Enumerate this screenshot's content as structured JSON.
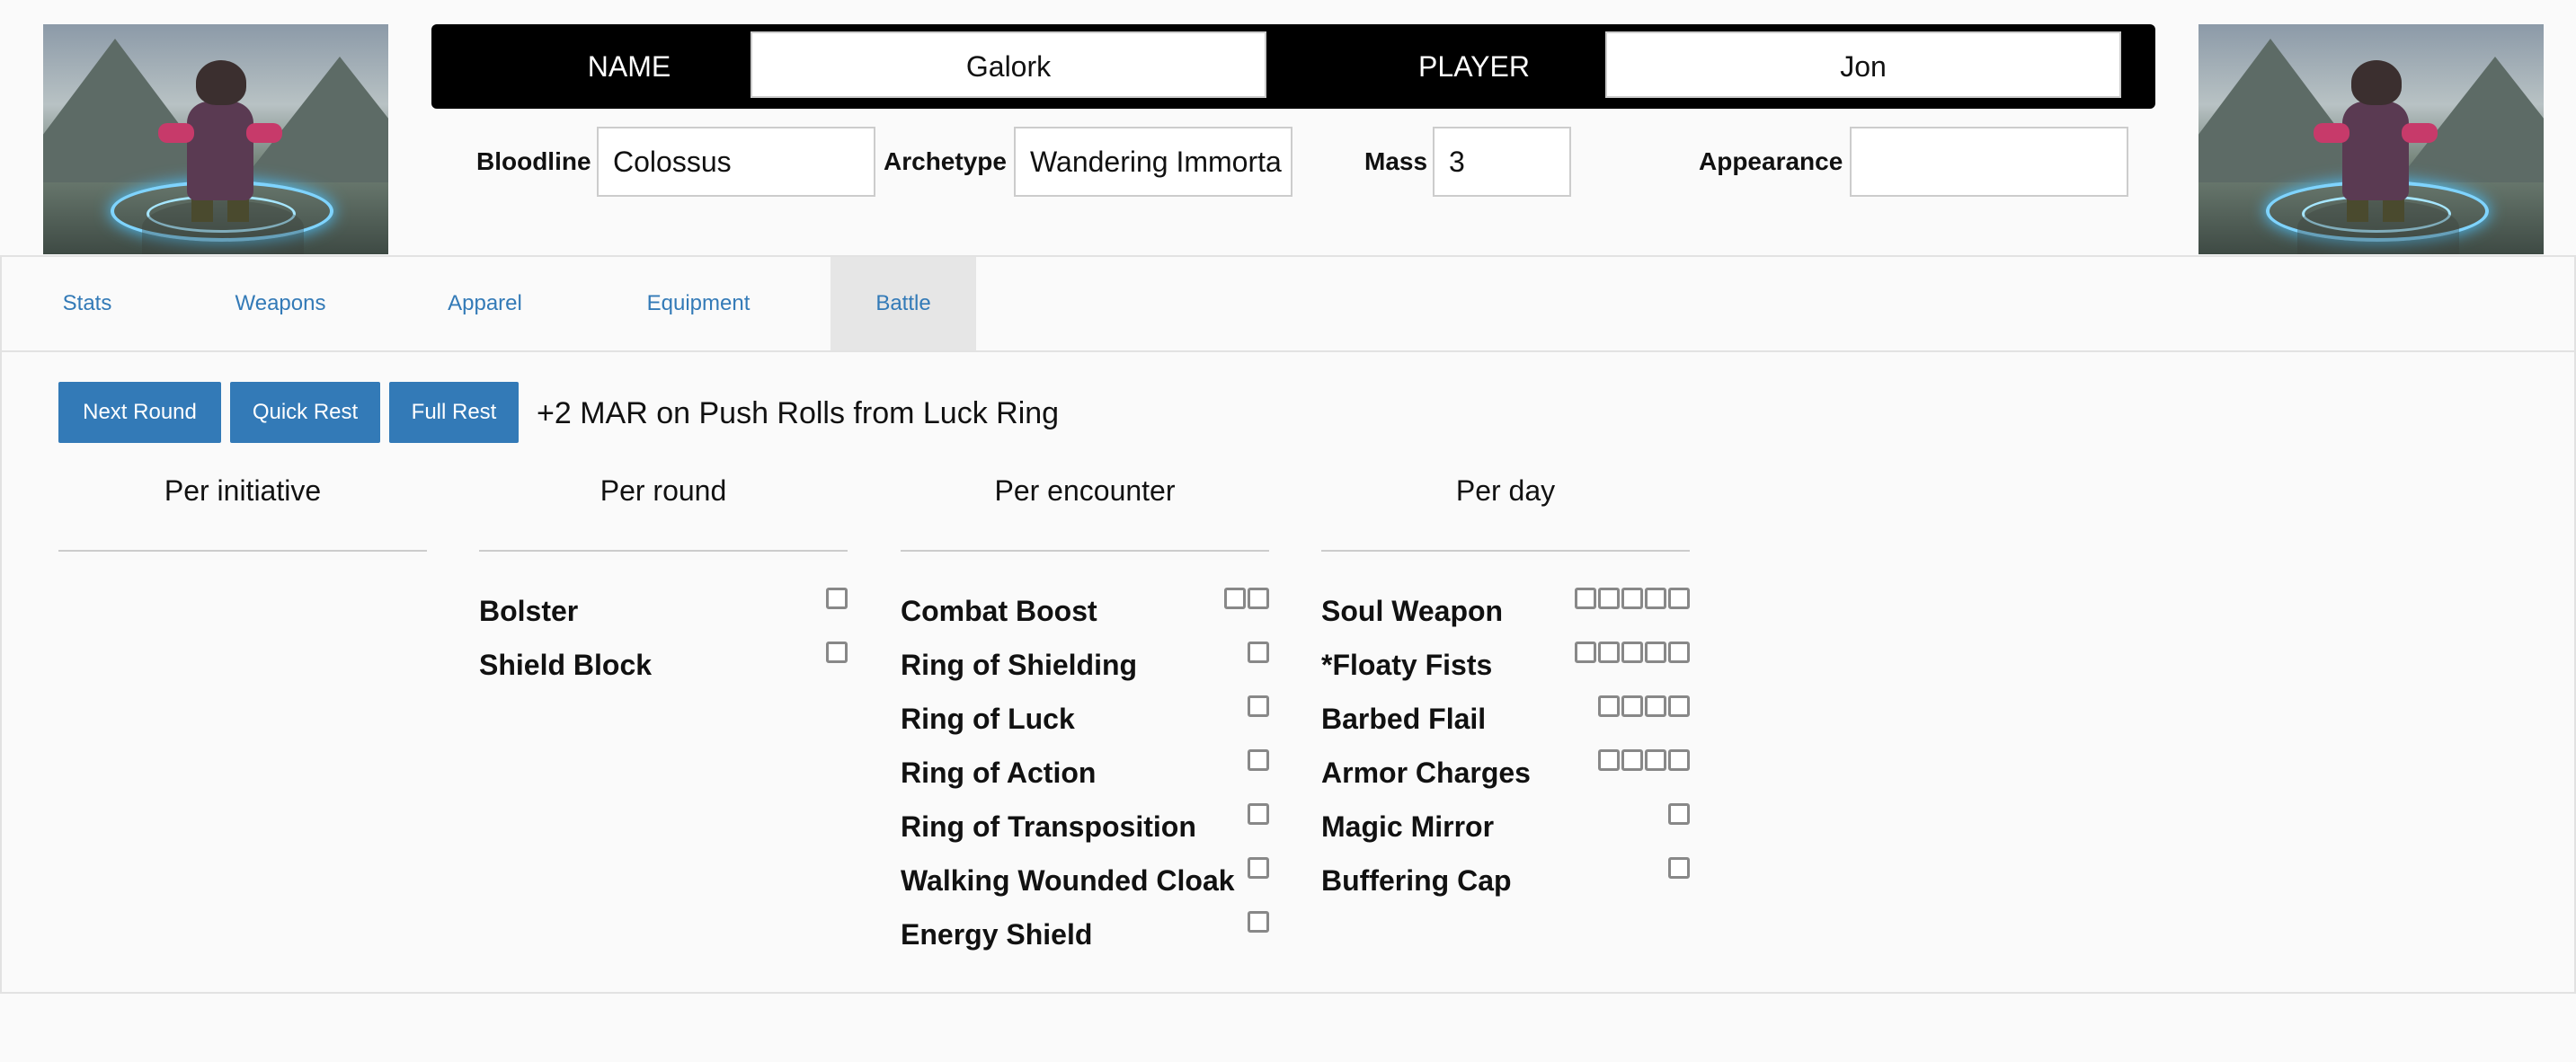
{
  "header": {
    "name_label": "NAME",
    "name_value": "Galork",
    "player_label": "PLAYER",
    "player_value": "Jon",
    "bloodline_label": "Bloodline",
    "bloodline_value": "Colossus",
    "archetype_label": "Archetype",
    "archetype_value": "Wandering Immorta",
    "mass_label": "Mass",
    "mass_value": "3",
    "appearance_label": "Appearance",
    "appearance_value": ""
  },
  "tabs": [
    {
      "label": "Stats"
    },
    {
      "label": "Weapons"
    },
    {
      "label": "Apparel"
    },
    {
      "label": "Equipment"
    },
    {
      "label": "Battle",
      "active": true
    }
  ],
  "actions": {
    "next_round": "Next Round",
    "quick_rest": "Quick Rest",
    "full_rest": "Full Rest",
    "note": "+2 MAR on Push Rolls from Luck Ring"
  },
  "columns": {
    "per_initiative": {
      "title": "Per initiative",
      "items": []
    },
    "per_round": {
      "title": "Per round",
      "items": [
        {
          "label": "Bolster",
          "boxes": 1
        },
        {
          "label": "Shield Block",
          "boxes": 1
        }
      ]
    },
    "per_encounter": {
      "title": "Per encounter",
      "items": [
        {
          "label": "Combat Boost",
          "boxes": 2
        },
        {
          "label": "Ring of Shielding",
          "boxes": 1
        },
        {
          "label": "Ring of Luck",
          "boxes": 1
        },
        {
          "label": "Ring of Action",
          "boxes": 1
        },
        {
          "label": "Ring of Transposition",
          "boxes": 1
        },
        {
          "label": "Walking Wounded Cloak",
          "boxes": 1
        },
        {
          "label": "Energy Shield",
          "boxes": 1
        }
      ]
    },
    "per_day": {
      "title": "Per day",
      "items": [
        {
          "label": "Soul Weapon",
          "boxes": 5
        },
        {
          "label": "*Floaty Fists",
          "boxes": 5
        },
        {
          "label": "Barbed Flail",
          "boxes": 4
        },
        {
          "label": "Armor Charges",
          "boxes": 4
        },
        {
          "label": "Magic Mirror",
          "boxes": 1
        },
        {
          "label": "Buffering Cap",
          "boxes": 1
        }
      ]
    }
  },
  "colors": {
    "accent": "#337ab7",
    "header_bg": "#000000"
  }
}
